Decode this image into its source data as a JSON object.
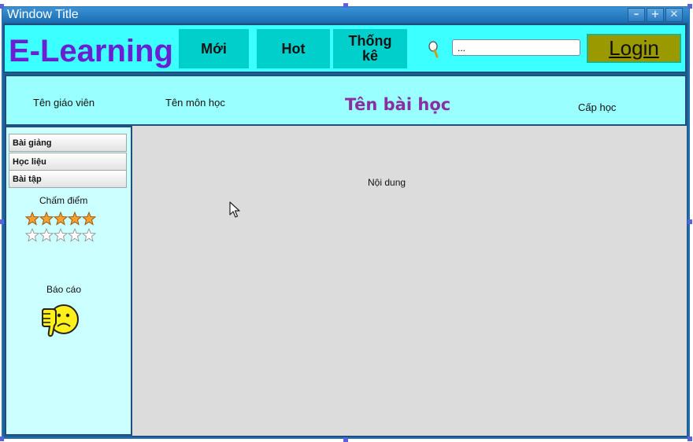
{
  "window": {
    "title": "Window Title",
    "controls": [
      "minimize-icon",
      "maximize-icon",
      "close-icon"
    ]
  },
  "header": {
    "logo": "E-Learning",
    "nav": [
      "Mới",
      "Hot",
      "Thống\nkê"
    ],
    "search": {
      "value": "...",
      "icon": "search-icon"
    },
    "login_label": "Login"
  },
  "info": {
    "teacher": "Tên giáo viên",
    "subject": "Tên môn học",
    "lesson": "Tên bài học",
    "level": "Cấp học"
  },
  "sidebar": {
    "buttons": [
      "Bài giảng",
      "Học liệu",
      "Bài tập"
    ],
    "score_label": "Chấm điểm",
    "report_label": "Báo cáo"
  },
  "rating": [
    {
      "filled": 5,
      "max": 5
    },
    {
      "filled": 0,
      "max": 5
    }
  ],
  "content": {
    "label": "Nội dung"
  },
  "colors": {
    "header_bg": "#3cffff",
    "logo": "#6a1fd0",
    "nav_bg": "#00cfcc",
    "login_bg": "#9a9a00",
    "lesson_title": "#8a2fa0",
    "sidebar_bg": "#ccffff",
    "content_bg": "#dcdcdc"
  }
}
